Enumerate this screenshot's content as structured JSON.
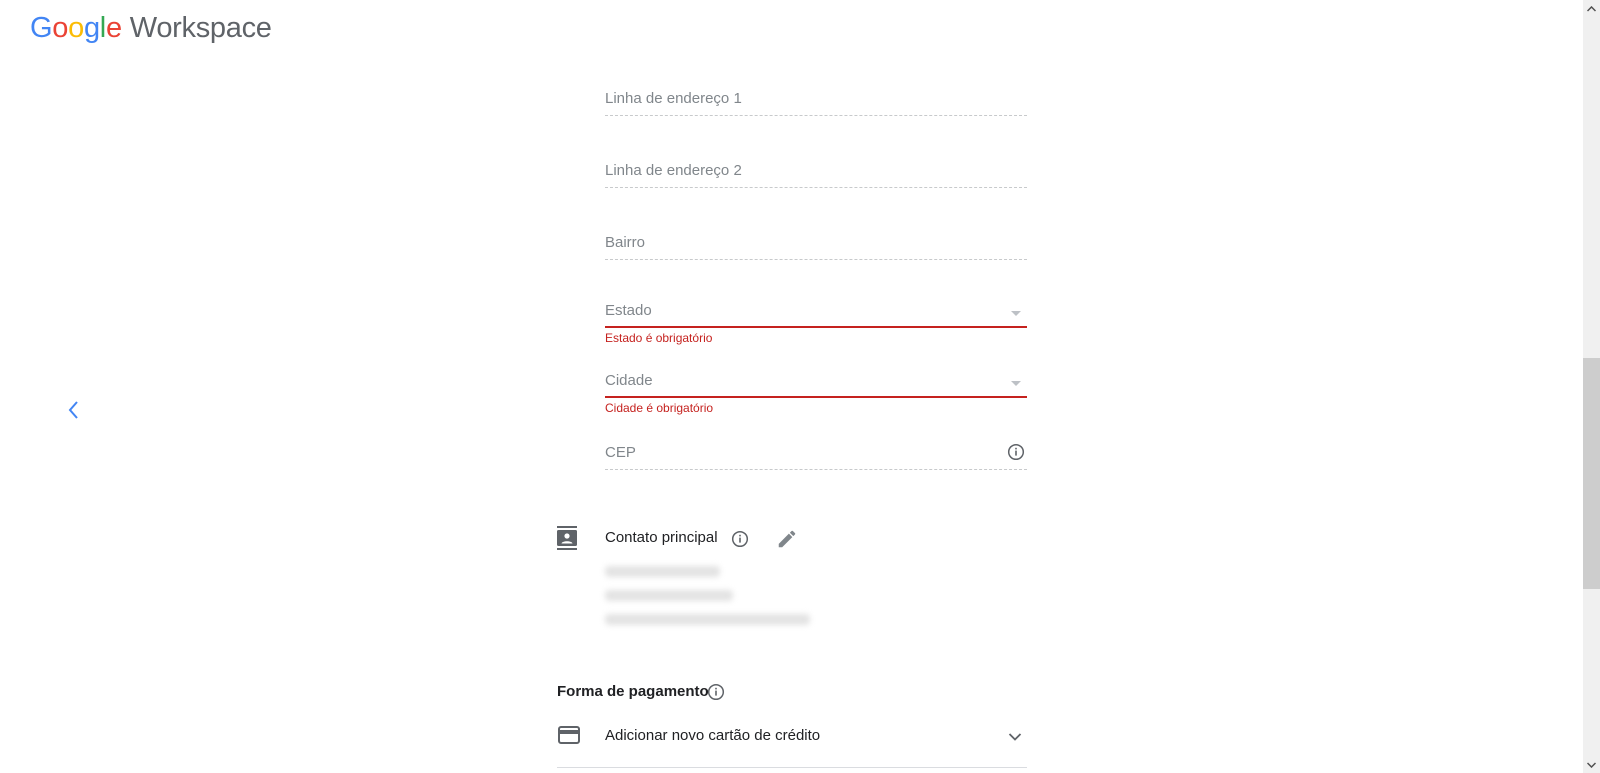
{
  "header": {
    "logo": {
      "google_letters": [
        "G",
        "o",
        "o",
        "g",
        "l",
        "e"
      ],
      "product": "Workspace"
    }
  },
  "navigation": {
    "back_icon": "chevron-left-icon"
  },
  "address_form": {
    "fields": [
      {
        "name": "address-line-1",
        "label": "Linha de endereço 1",
        "value": "",
        "type": "text"
      },
      {
        "name": "address-line-2",
        "label": "Linha de endereço 2",
        "value": "",
        "type": "text"
      },
      {
        "name": "neighborhood",
        "label": "Bairro",
        "value": "",
        "type": "text"
      },
      {
        "name": "state",
        "label": "Estado",
        "value": "",
        "type": "select",
        "error": "Estado é obrigatório"
      },
      {
        "name": "city",
        "label": "Cidade",
        "value": "",
        "type": "select",
        "error": "Cidade é obrigatório"
      },
      {
        "name": "postal-code",
        "label": "CEP",
        "value": "",
        "type": "text",
        "icon": "info-icon"
      }
    ]
  },
  "contact": {
    "title": "Contato principal",
    "icon": "contact-card-icon",
    "info_icon": "info-icon",
    "edit_icon": "pencil-icon",
    "details_redacted": true
  },
  "payment": {
    "title": "Forma de pagamento",
    "info_icon": "info-icon",
    "option_label": "Adicionar novo cartão de crédito",
    "option_icon": "credit-card-icon",
    "expand_icon": "chevron-down-icon"
  },
  "colors": {
    "error": "#c5221f",
    "accent": "#4285f4",
    "label": "#80868b",
    "icon": "#5f6368"
  }
}
